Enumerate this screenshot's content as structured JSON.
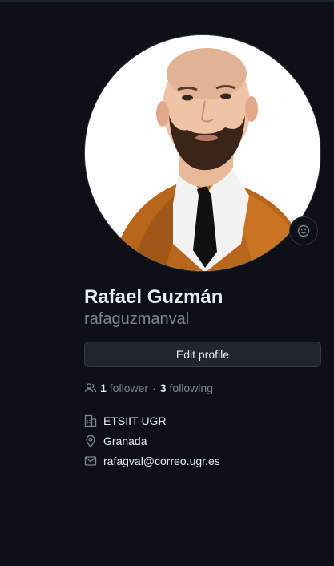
{
  "profile": {
    "full_name": "Rafael Guzmán",
    "username": "rafaguzmanval",
    "avatar_icon": "profile-photo",
    "status_icon": "smiley-icon"
  },
  "actions": {
    "edit_profile_label": "Edit profile"
  },
  "social": {
    "followers_count": "1",
    "followers_label": "follower",
    "separator": "·",
    "following_count": "3",
    "following_label": "following"
  },
  "details": {
    "organization": "ETSIIT-UGR",
    "location": "Granada",
    "email": "rafagval@correo.ugr.es"
  },
  "colors": {
    "background": "#0d1117",
    "text_primary": "#e6edf3",
    "text_muted": "#7d8590",
    "button_bg": "#21262d",
    "border": "#30363d"
  }
}
